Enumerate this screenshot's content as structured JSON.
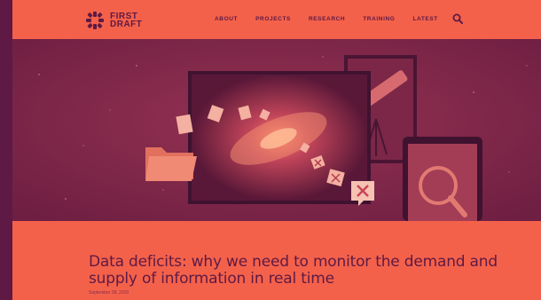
{
  "brand": {
    "line1": "FIRST",
    "line2": "DRAFT"
  },
  "nav": {
    "items": [
      {
        "label": "ABOUT"
      },
      {
        "label": "PROJECTS"
      },
      {
        "label": "RESEARCH"
      },
      {
        "label": "TRAINING"
      },
      {
        "label": "LATEST"
      }
    ],
    "search_icon": "search-icon"
  },
  "article": {
    "title": "Data deficits: why we need to monitor the demand and supply of information in real time",
    "date": "September 28, 2020"
  },
  "colors": {
    "background": "#5e1a45",
    "accent": "#f4614a",
    "hero": "#7c2748"
  }
}
